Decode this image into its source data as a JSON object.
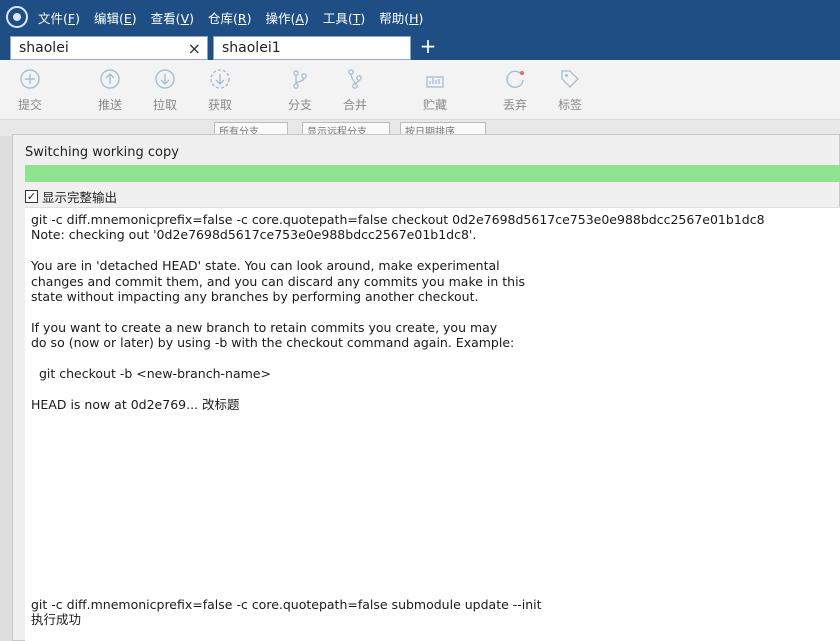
{
  "menubar": {
    "items": [
      {
        "text": "文件(",
        "key": "F",
        "end": ")"
      },
      {
        "text": "编辑(",
        "key": "E",
        "end": ")"
      },
      {
        "text": "查看(",
        "key": "V",
        "end": ")"
      },
      {
        "text": "仓库(",
        "key": "R",
        "end": ")"
      },
      {
        "text": "操作(",
        "key": "A",
        "end": ")"
      },
      {
        "text": "工具(",
        "key": "T",
        "end": ")"
      },
      {
        "text": "帮助(",
        "key": "H",
        "end": ")"
      }
    ]
  },
  "tabs": [
    {
      "label": "shaolei",
      "active": true
    },
    {
      "label": "shaolei1",
      "active": false
    }
  ],
  "tab_close": "×",
  "tab_add": "+",
  "toolbar": {
    "buttons": [
      {
        "label": "提交",
        "icon": "plus-circle-icon"
      },
      {
        "label": "推送",
        "icon": "arrow-up-circle-icon"
      },
      {
        "label": "拉取",
        "icon": "arrow-down-circle-icon"
      },
      {
        "label": "获取",
        "icon": "dashed-arrow-down-circle-icon"
      },
      {
        "label": "分支",
        "icon": "branch-icon"
      },
      {
        "label": "合并",
        "icon": "merge-icon"
      },
      {
        "label": "贮藏",
        "icon": "stash-icon"
      },
      {
        "label": "丢弃",
        "icon": "discard-icon"
      },
      {
        "label": "标签",
        "icon": "tag-icon"
      }
    ]
  },
  "filters": {
    "branches": "所有分支",
    "remote": "显示远程分支",
    "sort": "按日期排序"
  },
  "dialog": {
    "title": "Switching working copy",
    "progress": 1.0,
    "show_full_output_label": "显示完整输出",
    "show_full_output_checked": true,
    "output_lines": [
      "git -c diff.mnemonicprefix=false -c core.quotepath=false checkout 0d2e7698d5617ce753e0e988bdcc2567e01b1dc8",
      "Note: checking out '0d2e7698d5617ce753e0e988bdcc2567e01b1dc8'.",
      "",
      "You are in 'detached HEAD' state. You can look around, make experimental",
      "changes and commit them, and you can discard any commits you make in this",
      "state without impacting any branches by performing another checkout.",
      "",
      "If you want to create a new branch to retain commits you create, you may",
      "do so (now or later) by using -b with the checkout command again. Example:",
      "",
      "  git checkout -b <new-branch-name>",
      "",
      "HEAD is now at 0d2e769... 改标题",
      "",
      "",
      "",
      "",
      "",
      "",
      "",
      "",
      "",
      "",
      "",
      "",
      "git -c diff.mnemonicprefix=false -c core.quotepath=false submodule update --init",
      "执行成功"
    ]
  },
  "colors": {
    "menubar_bg": "#1f4e85",
    "progress_fill": "#8fe38f",
    "toolbar_icon": "#9fb3c9"
  }
}
